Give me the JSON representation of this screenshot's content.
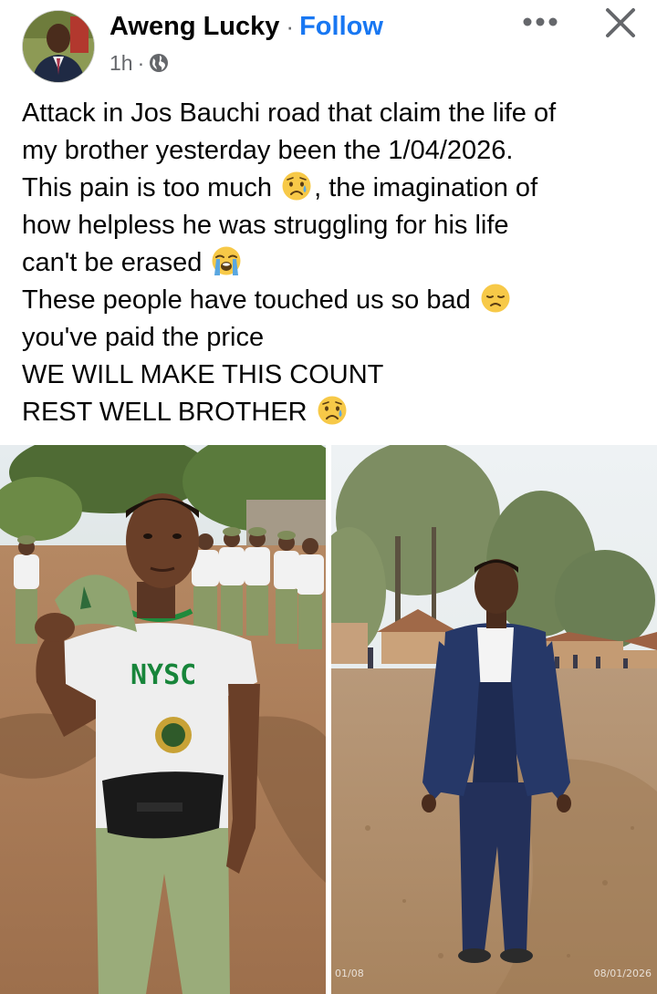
{
  "post": {
    "author": "Aweng Lucky",
    "separator": "·",
    "follow_label": "Follow",
    "time": "1h",
    "time_separator": "·",
    "audience_icon": "globe-icon",
    "more_icon": "more-icon",
    "close_icon": "close-icon",
    "lines": {
      "l1": "Attack in Jos Bauchi road that claim the life of",
      "l2": "my brother yesterday been the 1/04/2026.",
      "l3a": "This pain is too much ",
      "l3b": ", the imagination of",
      "l4": "how helpless he was struggling for his life",
      "l5": "can't be erased ",
      "l6": "These people have touched us so bad ",
      "l7": "you've paid the price",
      "l8": "WE WILL MAKE THIS COUNT",
      "l9": "REST WELL BROTHER "
    },
    "emojis": [
      "sad-but-relieved-emoji",
      "loudly-crying-emoji",
      "disappointed-emoji",
      "sad-but-relieved-emoji"
    ]
  },
  "photos": [
    {
      "name": "nysc-photo",
      "shirt_text": "NYSC",
      "stamp": ""
    },
    {
      "name": "suit-photo",
      "stamp_left": "01/08",
      "stamp_right": "08/01/2026"
    }
  ],
  "colors": {
    "link_blue": "#1877f2",
    "secondary_text": "#65676b",
    "primary_text": "#050505"
  }
}
